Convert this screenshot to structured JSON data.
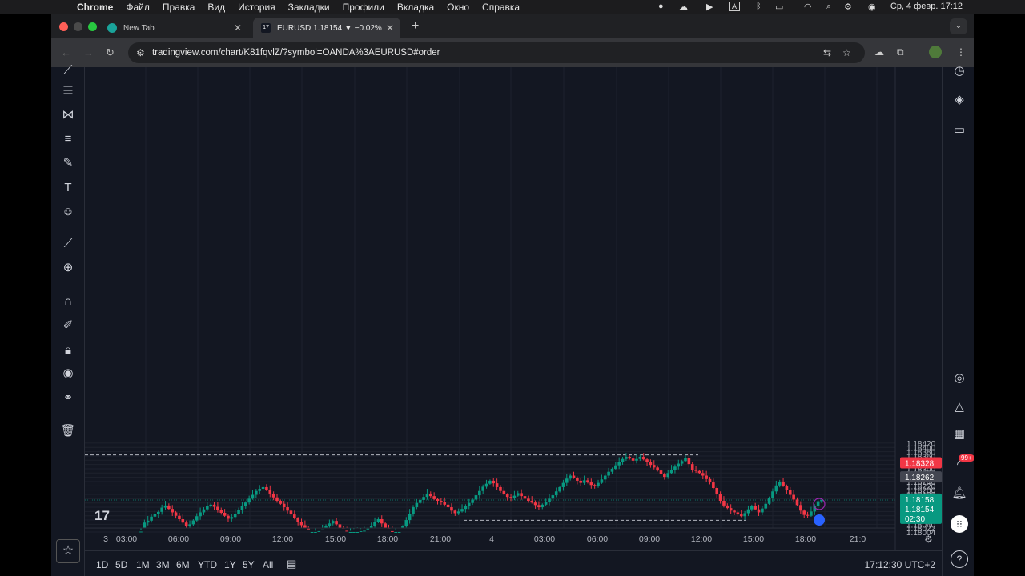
{
  "menubar": {
    "app": "Chrome",
    "items": [
      "Файл",
      "Правка",
      "Вид",
      "История",
      "Закладки",
      "Профили",
      "Вкладка",
      "Окно",
      "Справка"
    ],
    "datetime": "Ср, 4 февр.  17:12"
  },
  "tabs": [
    {
      "title": "New Tab",
      "active": false
    },
    {
      "title": "EURUSD 1.18154 ▼ −0.02% U",
      "active": true
    }
  ],
  "address": {
    "url": "tradingview.com/chart/K81fqvlZ/?symbol=OANDA%3AEURUSD#order"
  },
  "colors": {
    "bg": "#131722",
    "up": "#089981",
    "down": "#f23645",
    "grid": "#1e222d",
    "axis_text": "#b2b5be"
  },
  "left_tools": [
    "crosshair-icon",
    "lines-icon",
    "pattern-icon",
    "fib-icon",
    "brush-icon",
    "text-icon",
    "emoji-icon",
    "ruler-icon",
    "zoom-icon",
    "magnet-icon",
    "lock-draw-icon",
    "lock-icon",
    "eye-icon",
    "link-icon",
    "trash-icon"
  ],
  "right_tools": [
    "clock-icon",
    "layers-icon",
    "chat-icon",
    "target-icon",
    "triangle-icon",
    "calendar-icon",
    "signal-icon",
    "bell-icon",
    "grid-icon",
    "help-icon"
  ],
  "notification_badge": "99+",
  "bottom": {
    "timeframes": [
      "1D",
      "5D",
      "1M",
      "3M",
      "6M",
      "YTD",
      "1Y",
      "5Y",
      "All"
    ],
    "clock": "17:12:30 UTC+2"
  },
  "chart_data": {
    "type": "candlestick",
    "symbol": "EURUSD",
    "yaxis_ticks": [
      "1.18420",
      "1.18400",
      "1.18380",
      "1.18360",
      "1.18340",
      "1.18320",
      "1.18300",
      "1.18280",
      "1.18260",
      "1.18240",
      "1.18220",
      "1.18200",
      "1.18180",
      "1.18160",
      "1.18140",
      "1.18120",
      "1.18100",
      "1.18080",
      "1.18060",
      "1.18040",
      "1.18022",
      "1.18004"
    ],
    "xaxis_ticks": [
      "3",
      "03:00",
      "06:00",
      "09:00",
      "12:00",
      "15:00",
      "18:00",
      "21:00",
      "4",
      "03:00",
      "06:00",
      "09:00",
      "12:00",
      "15:00",
      "18:00",
      "21:0"
    ],
    "price_labels": {
      "high_marker": "1.18328",
      "crosshair": "1.18262",
      "current_a": "1.18158",
      "current_b": "1.18154",
      "countdown": "02:30"
    },
    "ylim": [
      1.18,
      1.18425
    ],
    "dashed_levels": [
      1.18365,
      1.18059
    ],
    "current_price": 1.18154,
    "closes": [
      1.18006,
      1.18048,
      1.18057,
      1.18076,
      1.18088,
      1.18098,
      1.18118,
      1.18128,
      1.18112,
      1.18096,
      1.1808,
      1.18064,
      1.18048,
      1.18032,
      1.1804,
      1.18058,
      1.18078,
      1.18096,
      1.1811,
      1.18124,
      1.18132,
      1.18122,
      1.18108,
      1.18094,
      1.1808,
      1.18066,
      1.18074,
      1.1809,
      1.18108,
      1.18126,
      1.18142,
      1.1816,
      1.18178,
      1.18196,
      1.18206,
      1.18214,
      1.182,
      1.18184,
      1.18166,
      1.1815,
      1.18136,
      1.1812,
      1.18104,
      1.18086,
      1.18068,
      1.18052,
      1.18036,
      1.1802,
      1.18004,
      1.18004,
      1.18004,
      1.18008,
      1.18016,
      1.1803,
      1.18044,
      1.18056,
      1.1804,
      1.18024,
      1.1801,
      1.18004,
      1.18004,
      1.18004,
      1.18004,
      1.18008,
      1.1801,
      1.1802,
      1.18034,
      1.1805,
      1.18064,
      1.18044,
      1.18024,
      1.18008,
      1.18004,
      1.18004,
      1.18004,
      1.1803,
      1.1806,
      1.1809,
      1.1812,
      1.1814,
      1.18154,
      1.18168,
      1.18184,
      1.18172,
      1.18158,
      1.1815,
      1.18144,
      1.18132,
      1.1812,
      1.18104,
      1.18092,
      1.181,
      1.18112,
      1.18124,
      1.1814,
      1.18156,
      1.18176,
      1.18196,
      1.18216,
      1.1823,
      1.18244,
      1.18232,
      1.18214,
      1.18196,
      1.1818,
      1.18168,
      1.18162,
      1.18174,
      1.18186,
      1.18172,
      1.1816,
      1.1815,
      1.18142,
      1.1813,
      1.1812,
      1.18132,
      1.18146,
      1.1816,
      1.18176,
      1.18194,
      1.18214,
      1.18234,
      1.18254,
      1.18268,
      1.18258,
      1.18244,
      1.18234,
      1.18246,
      1.18236,
      1.18224,
      1.1822,
      1.18234,
      1.1825,
      1.18268,
      1.18286,
      1.183,
      1.18316,
      1.18332,
      1.18346,
      1.18356,
      1.18348,
      1.18338,
      1.18346,
      1.18356,
      1.18344,
      1.1833,
      1.18318,
      1.18306,
      1.18292,
      1.18276,
      1.18262,
      1.1828,
      1.18296,
      1.1831,
      1.18324,
      1.18336,
      1.1835,
      1.18322,
      1.18296,
      1.1829,
      1.1828,
      1.18268,
      1.18252,
      1.18236,
      1.1821,
      1.1818,
      1.1815,
      1.18128,
      1.18116,
      1.18104,
      1.18096,
      1.18086,
      1.18078,
      1.18092,
      1.1811,
      1.18126,
      1.1811,
      1.18096,
      1.18114,
      1.18136,
      1.18164,
      1.18194,
      1.18222,
      1.18238,
      1.1822,
      1.182,
      1.18178,
      1.18156,
      1.1813,
      1.18104,
      1.18084,
      1.1808,
      1.181,
      1.18124,
      1.18148,
      1.18154
    ]
  }
}
